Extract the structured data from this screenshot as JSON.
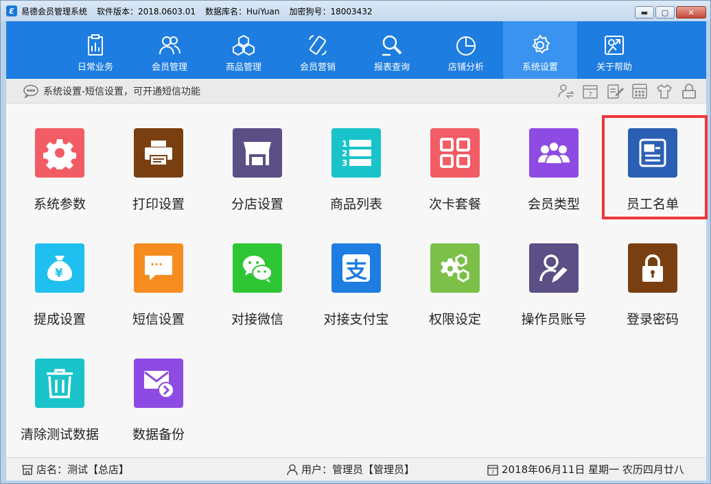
{
  "titlebar": {
    "app_name": "易德会员管理系统",
    "version": "软件版本：2018.0603.01",
    "database": "数据库名：HuiYuan",
    "dongle": "加密狗号：18003432",
    "minimize": "▬",
    "maximize": "▢",
    "close": "✕"
  },
  "nav": {
    "items": [
      {
        "label": "日常业务",
        "icon": "clipboard-chart-icon"
      },
      {
        "label": "会员管理",
        "icon": "users-icon"
      },
      {
        "label": "商品管理",
        "icon": "boxes-icon"
      },
      {
        "label": "会员营销",
        "icon": "phone-icon"
      },
      {
        "label": "报表查询",
        "icon": "magnifier-icon"
      },
      {
        "label": "店铺分析",
        "icon": "pie-chart-icon"
      },
      {
        "label": "系统设置",
        "icon": "gear-icon"
      },
      {
        "label": "关于帮助",
        "icon": "help-icon"
      }
    ],
    "active_index": 6,
    "color": "#1e7de0",
    "active_color": "#3a93ee"
  },
  "breadcrumb": {
    "text": "系统设置-短信设置，可开通短信功能"
  },
  "tiles": [
    {
      "label": "系统参数",
      "color": "#f25c64",
      "icon": "gear-icon"
    },
    {
      "label": "打印设置",
      "color": "#7a3f10",
      "icon": "printer-icon"
    },
    {
      "label": "分店设置",
      "color": "#5b4f86",
      "icon": "store-icon"
    },
    {
      "label": "商品列表",
      "color": "#19c3c9",
      "icon": "numbered-list-icon"
    },
    {
      "label": "次卡套餐",
      "color": "#f25c64",
      "icon": "grid-icon"
    },
    {
      "label": "会员类型",
      "color": "#8e4be3",
      "icon": "members-icon"
    },
    {
      "label": "员工名单",
      "color": "#2b5fb3",
      "icon": "id-card-icon"
    },
    {
      "label": "提成设置",
      "color": "#1fc0f0",
      "icon": "money-bag-icon",
      "glyph": "¥"
    },
    {
      "label": "短信设置",
      "color": "#f68c1f",
      "icon": "message-icon",
      "glyph": "···"
    },
    {
      "label": "对接微信",
      "color": "#2fc636",
      "icon": "wechat-icon"
    },
    {
      "label": "对接支付宝",
      "color": "#1e7de0",
      "icon": "alipay-icon",
      "glyph": "支"
    },
    {
      "label": "权限设定",
      "color": "#7cc04a",
      "icon": "gears-icon"
    },
    {
      "label": "操作员账号",
      "color": "#5b4f86",
      "icon": "user-edit-icon"
    },
    {
      "label": "登录密码",
      "color": "#7a3f10",
      "icon": "lock-icon"
    },
    {
      "label": "清除测试数据",
      "color": "#19c3c9",
      "icon": "trash-icon"
    },
    {
      "label": "数据备份",
      "color": "#8e4be3",
      "icon": "mail-backup-icon"
    }
  ],
  "status": {
    "store": "店名：测试【总店】",
    "user": "用户：管理员【管理员】",
    "date": "2018年06月11日 星期一 农历四月廿八"
  }
}
